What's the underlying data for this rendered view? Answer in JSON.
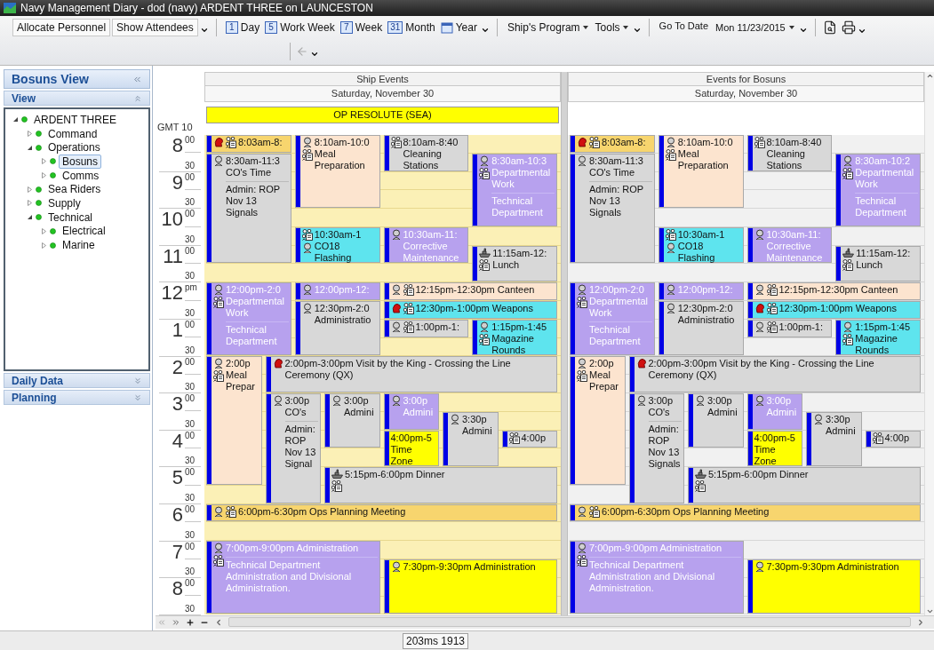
{
  "window": {
    "title": "Navy Management Diary - dod (navy) ARDENT THREE on LAUNCESTON"
  },
  "toolbar": {
    "groups": [
      {
        "items": [
          {
            "kind": "button",
            "label": "Allocate Personnel"
          },
          {
            "kind": "button",
            "label": "Show Attendees"
          }
        ]
      },
      {
        "items": [
          {
            "kind": "view",
            "badge": "1",
            "label": "Day"
          },
          {
            "kind": "view",
            "badge": "5",
            "label": "Work Week"
          },
          {
            "kind": "view",
            "badge": "7",
            "label": "Week"
          },
          {
            "kind": "view",
            "badge": "31",
            "label": "Month"
          },
          {
            "kind": "year",
            "label": "Year"
          }
        ]
      },
      {
        "items": [
          {
            "kind": "menu",
            "label": "Ship's Program"
          },
          {
            "kind": "menu",
            "label": "Tools"
          }
        ]
      },
      {
        "items": [
          {
            "kind": "label",
            "label": "Go To Date"
          },
          {
            "kind": "date",
            "label": "Mon 11/23/2015"
          }
        ]
      }
    ]
  },
  "sidebar": {
    "title": "Bosuns View",
    "sections": [
      {
        "label": "View",
        "expanded": true
      },
      {
        "label": "Daily Data",
        "expanded": false
      },
      {
        "label": "Planning",
        "expanded": false
      }
    ],
    "tree": [
      {
        "label": "ARDENT THREE",
        "expanded": true,
        "selected": false,
        "children": [
          {
            "label": "Command",
            "expanded": false,
            "selected": false
          },
          {
            "label": "Operations",
            "expanded": true,
            "selected": false,
            "children": [
              {
                "label": "Bosuns",
                "expanded": false,
                "selected": true
              },
              {
                "label": "Comms",
                "expanded": false,
                "selected": false
              }
            ]
          },
          {
            "label": "Sea Riders",
            "expanded": false,
            "selected": false
          },
          {
            "label": "Supply",
            "expanded": false,
            "selected": false
          },
          {
            "label": "Technical",
            "expanded": true,
            "selected": false,
            "children": [
              {
                "label": "Electrical",
                "expanded": false,
                "selected": false
              },
              {
                "label": "Marine",
                "expanded": false,
                "selected": false
              }
            ]
          }
        ]
      }
    ]
  },
  "calendar": {
    "timezone": "GMT 10",
    "hours": [
      {
        "hour": "8",
        "minutes": "00",
        "half": "30"
      },
      {
        "hour": "9",
        "minutes": "00",
        "half": "30"
      },
      {
        "hour": "10",
        "minutes": "00",
        "half": "30"
      },
      {
        "hour": "11",
        "minutes": "00",
        "half": "30"
      },
      {
        "hour": "12",
        "minutes": "pm",
        "half": "30"
      },
      {
        "hour": "1",
        "minutes": "00",
        "half": "30"
      },
      {
        "hour": "2",
        "minutes": "00",
        "half": "30"
      },
      {
        "hour": "3",
        "minutes": "00",
        "half": "30"
      },
      {
        "hour": "4",
        "minutes": "00",
        "half": "30"
      },
      {
        "hour": "5",
        "minutes": "00",
        "half": "30"
      },
      {
        "hour": "6",
        "minutes": "00",
        "half": "30"
      },
      {
        "hour": "7",
        "minutes": "00",
        "half": "30"
      },
      {
        "hour": "8",
        "minutes": "00",
        "half": "30"
      }
    ],
    "columns": [
      {
        "title": "Ship Events",
        "date": "Saturday, November 30",
        "shaded": true,
        "all_day": [
          {
            "text": "OP RESOLUTE (SEA)",
            "color": "#ffff00"
          }
        ],
        "events": [
          {
            "heading": "8:03am-8:",
            "color": "#f7d56e"
          },
          {
            "heading": "8:30am-11:3",
            "title": "CO's Time",
            "description": "Admin: ROP Nov 13 Signals",
            "color": "#d8d8d8"
          },
          {
            "heading": "8:10am-10:0",
            "title": "Meal Preparation",
            "color": "#fce4cf"
          },
          {
            "heading": "8:10am-8:40",
            "title": "Cleaning Stations",
            "color": "#d8d8d8"
          },
          {
            "heading": "8:30am-10:3",
            "title": "Departmental Work",
            "description": "Technical Department",
            "color": "#b7a1ee"
          },
          {
            "heading": "10:30am-1",
            "title": "CO18 Flashing",
            "color": "#5ee4ee"
          },
          {
            "heading": "10:30am-11:",
            "title": "Corrective Maintenance",
            "color": "#b7a1ee"
          },
          {
            "heading": "11:15am-12:",
            "title": "Lunch",
            "color": "#d8d8d8"
          },
          {
            "heading": "12:00pm-2:0",
            "title": "Departmental Work",
            "description": "Technical Department",
            "color": "#b7a1ee"
          },
          {
            "heading": "12:00pm-12:",
            "color": "#b7a1ee"
          },
          {
            "heading": "12:30pm-2:0",
            "title": "Administratio",
            "color": "#d8d8d8"
          },
          {
            "heading": "12:15pm-12:30pm Canteen",
            "color": "#fce4cf"
          },
          {
            "heading": "12:30pm-1:00pm Weapons",
            "color": "#5ee4ee"
          },
          {
            "heading": "1:00pm-1:",
            "color": "#d8d8d8"
          },
          {
            "heading": "1:15pm-1:45",
            "title": "Magazine Rounds",
            "color": "#5ee4ee"
          },
          {
            "heading": "2:00p",
            "title": "Meal Prepar",
            "color": "#fce4cf"
          },
          {
            "heading": "2:00pm-3:00pm Visit by the King - Crossing the Line Ceremony (QX)",
            "color": "#d8d8d8"
          },
          {
            "heading": "3:00p",
            "title": "CO's",
            "description": "Admin: ROP Nov 13 Signal",
            "color": "#d8d8d8"
          },
          {
            "heading": "3:00p",
            "title": "Admini",
            "color": "#d8d8d8"
          },
          {
            "heading": "3:00p",
            "title": "Admini",
            "color": "#b7a1ee"
          },
          {
            "heading": "4:00pm-5",
            "title": "Time Zone",
            "color": "#ffff00"
          },
          {
            "heading": "3:30p",
            "title": "Admini",
            "color": "#d8d8d8"
          },
          {
            "heading": "4:00p",
            "color": "#d8d8d8"
          },
          {
            "heading": "5:15pm-6:00pm Dinner",
            "color": "#d8d8d8"
          },
          {
            "heading": "6:00pm-6:30pm Ops Planning Meeting",
            "color": "#f7d56e"
          },
          {
            "heading": "7:00pm-9:00pm Administration",
            "description": "Technical Department Administration and Divisional Administration.",
            "color": "#b7a1ee"
          },
          {
            "heading": "7:30pm-9:30pm Administration",
            "color": "#ffff00"
          }
        ]
      },
      {
        "title": "Events for Bosuns",
        "date": "Saturday, November 30",
        "shaded": false,
        "events": [
          {
            "heading": "8:03am-8:",
            "color": "#f7d56e"
          },
          {
            "heading": "8:30am-11:3",
            "title": "CO's Time",
            "description": "Admin: ROP Nov 13 Signals",
            "color": "#d8d8d8"
          },
          {
            "heading": "8:10am-10:0",
            "title": "Meal Preparation",
            "color": "#fce4cf"
          },
          {
            "heading": "8:10am-8:40",
            "title": "Cleaning Stations",
            "color": "#d8d8d8"
          },
          {
            "heading": "8:30am-10:2",
            "title": "Departmental Work",
            "description": "Technical Department",
            "color": "#b7a1ee"
          },
          {
            "heading": "10:30am-1",
            "title": "CO18 Flashing",
            "color": "#5ee4ee"
          },
          {
            "heading": "10:30am-11:",
            "title": "Corrective Maintenance",
            "color": "#b7a1ee"
          },
          {
            "heading": "11:15am-12:",
            "title": "Lunch",
            "color": "#d8d8d8"
          },
          {
            "heading": "12:00pm-2:0",
            "title": "Departmental Work",
            "description": "Technical Department",
            "color": "#b7a1ee"
          },
          {
            "heading": "12:00pm-12:",
            "color": "#b7a1ee"
          },
          {
            "heading": "12:30pm-2:0",
            "title": "Administratio",
            "color": "#d8d8d8"
          },
          {
            "heading": "12:15pm-12:30pm Canteen",
            "color": "#fce4cf"
          },
          {
            "heading": "12:30pm-1:00pm Weapons",
            "color": "#5ee4ee"
          },
          {
            "heading": "1:00pm-1:",
            "color": "#d8d8d8"
          },
          {
            "heading": "1:15pm-1:45",
            "title": "Magazine Rounds",
            "color": "#5ee4ee"
          },
          {
            "heading": "2:00p",
            "title": "Meal Prepar",
            "color": "#fce4cf"
          },
          {
            "heading": "2:00pm-3:00pm Visit by the King - Crossing the Line Ceremony (QX)",
            "color": "#d8d8d8"
          },
          {
            "heading": "3:00p",
            "title": "CO's",
            "description": "Admin: ROP Nov 13 Signals",
            "color": "#d8d8d8"
          },
          {
            "heading": "3:00p",
            "title": "Admini",
            "color": "#d8d8d8"
          },
          {
            "heading": "3:00p",
            "title": "Admini",
            "color": "#b7a1ee"
          },
          {
            "heading": "4:00pm-5",
            "title": "Time Zone",
            "color": "#ffff00"
          },
          {
            "heading": "3:30p",
            "title": "Admini",
            "color": "#d8d8d8"
          },
          {
            "heading": "4:00p",
            "color": "#d8d8d8"
          },
          {
            "heading": "5:15pm-6:00pm Dinner",
            "color": "#d8d8d8"
          },
          {
            "heading": "6:00pm-6:30pm Ops Planning Meeting",
            "color": "#f7d56e"
          },
          {
            "heading": "7:00pm-9:00pm Administration",
            "description": "Technical Department Administration and Divisional Administration.",
            "color": "#b7a1ee"
          },
          {
            "heading": "7:30pm-9:30pm Administration",
            "color": "#ffff00"
          }
        ]
      }
    ]
  },
  "status_bar": {
    "text": "203ms 1913"
  }
}
